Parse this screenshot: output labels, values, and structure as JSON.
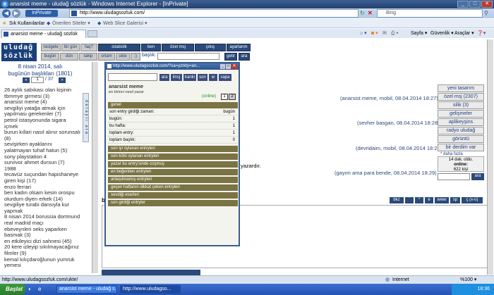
{
  "window": {
    "title": "anarsist meme - uludağ sözlük - Windows Internet Explorer - [InPrivate]"
  },
  "addressbar": {
    "inprivate": "InPrivate",
    "url": "http://www.uludagsozluk.com/",
    "search_placeholder": "Bing"
  },
  "favorites": {
    "fav_label": "Sık Kullanılanlar",
    "suggested": "Önerilen Siteler ▾",
    "webslice": "Web Slice Galerisi ▾"
  },
  "tab": {
    "title": "anarsist meme - uludağ sözlük"
  },
  "ietools": {
    "page": "Sayfa ▾",
    "safety": "Güvenlik ▾",
    "tools": "Araçlar ▾",
    "help": "❓▾"
  },
  "site": {
    "logo_line1": "uludağ",
    "logo_line2": "sözlük",
    "nav_row1": [
      "rastgele",
      "bir gün",
      "faq?",
      "istatistik",
      "ben",
      "özel msj",
      "çıkış",
      "ayarlarım"
    ],
    "nav_row2": [
      "bugün",
      "dün",
      "takip",
      "ortam",
      "ukte",
      ":)"
    ],
    "search_label": "başlık:",
    "go_btn": "getir",
    "search_btn": "ara"
  },
  "sidebar": {
    "date_line": "8 nisan 2014, salı",
    "count_line": "bugünün başlıkları (1801)",
    "page_current": "1",
    "page_total": "/ 37",
    "side_tab": "detaylı ara",
    "topics": [
      "26 aylık sabıkası olan kişinin tbmmye girmesi (3)",
      "anarsist meme (4)",
      "sevgiliyi yatağa atmak için yapılması gerekenler (7)",
      "petrol istasyonunda sigara içmek",
      "burun kıllari nasıl alınır sorunsalı (8)",
      "sevişirken ayaklarını yalatmayan tuhaf hatun (5)",
      "sony playstation 4",
      "survivor ahmet dursun (7)",
      "1988",
      "tecavüz suçundan hapishaneye giren kişi (17)",
      "enzo ferrari",
      "ben kadın olsam kesin orospu olurdum diyen erkek (14)",
      "sevgiliye turabi dansıyla kur yapmak",
      "8 nisan 2014 borussia dortmund real madrid maçı",
      "ebeveynleri seks yaparken basmak (3)",
      "en etkileyici dizi sahnesi (45)",
      "20 kere izleyip sıkılmayacağınız filmler (9)",
      "kemal kılıçdaroğlunun yumruk yemesi"
    ]
  },
  "main": {
    "title_initial": "a",
    "entries": [
      {
        "meta": "(anarsist meme, mobil, 08.04.2014 18:27)"
      },
      {
        "meta": "(sevher basgan, 08.04.2014 18:28)"
      },
      {
        "meta": "(devridaim, mobil, 08.04.2014 18:28)"
      },
      {
        "meta": "(gayım ama para bende, 08.04.2014 18:29)"
      }
    ],
    "partial_text": "yazardır.",
    "editor_buttons": [
      "bkz",
      "`",
      "*",
      "e",
      "www",
      "sp",
      "ç (x-o)"
    ]
  },
  "right_menu": {
    "items": [
      "yeni tasarım",
      "özel msj (2307)",
      "silik (3)",
      "gelişmeler",
      "aplikeyşins",
      "radyo uludağ",
      "görüntü",
      "bir derdim var"
    ],
    "more": "* daha fazla",
    "online_line1": "14 dak. oldu.",
    "online_line2": "online:",
    "online_line3": "622 kişi",
    "search_btn": "ara"
  },
  "popup": {
    "title_url": "http://www.uludagsozluk.com/?sa=yzrkty=an...",
    "buttons": [
      "ara",
      "ilnsj",
      "kanki",
      "son",
      "w",
      "sapa"
    ],
    "user_name": "anarsist meme",
    "user_desc": "en birinci nesil yazar",
    "online_label": "(online)",
    "tab1": "1",
    "tab2": "2",
    "section_general": "genel",
    "stats": [
      {
        "label": "son entry girdiği zaman:",
        "value": "bugün"
      },
      {
        "label": "bugün:",
        "value": "1"
      },
      {
        "label": "bu hafta:",
        "value": "1"
      },
      {
        "label": "toplam entry:",
        "value": "1"
      },
      {
        "label": "toplam başlık:",
        "value": "0"
      }
    ],
    "sections": [
      "son iyi oylanan entryleri",
      "son kötü oylanan entryleri",
      "yazar bu entry'sinde coşmuş",
      "en beğenilen entryleri",
      "anlaşılmamış entryleri",
      "geçen haftanın dikkat çeken entryleri",
      "sevdiği eserleri",
      "son girdiği entryler"
    ]
  },
  "statusbar": {
    "text": "http://www.uludagsozluk.com/ukte/",
    "zone": "Internet",
    "zoom": "%100 ▾"
  },
  "taskbar": {
    "start": "Başlat",
    "tasks": [
      "anarsist meme - uludağ s...",
      "http://www.uludagso..."
    ],
    "clock": "18:36"
  }
}
